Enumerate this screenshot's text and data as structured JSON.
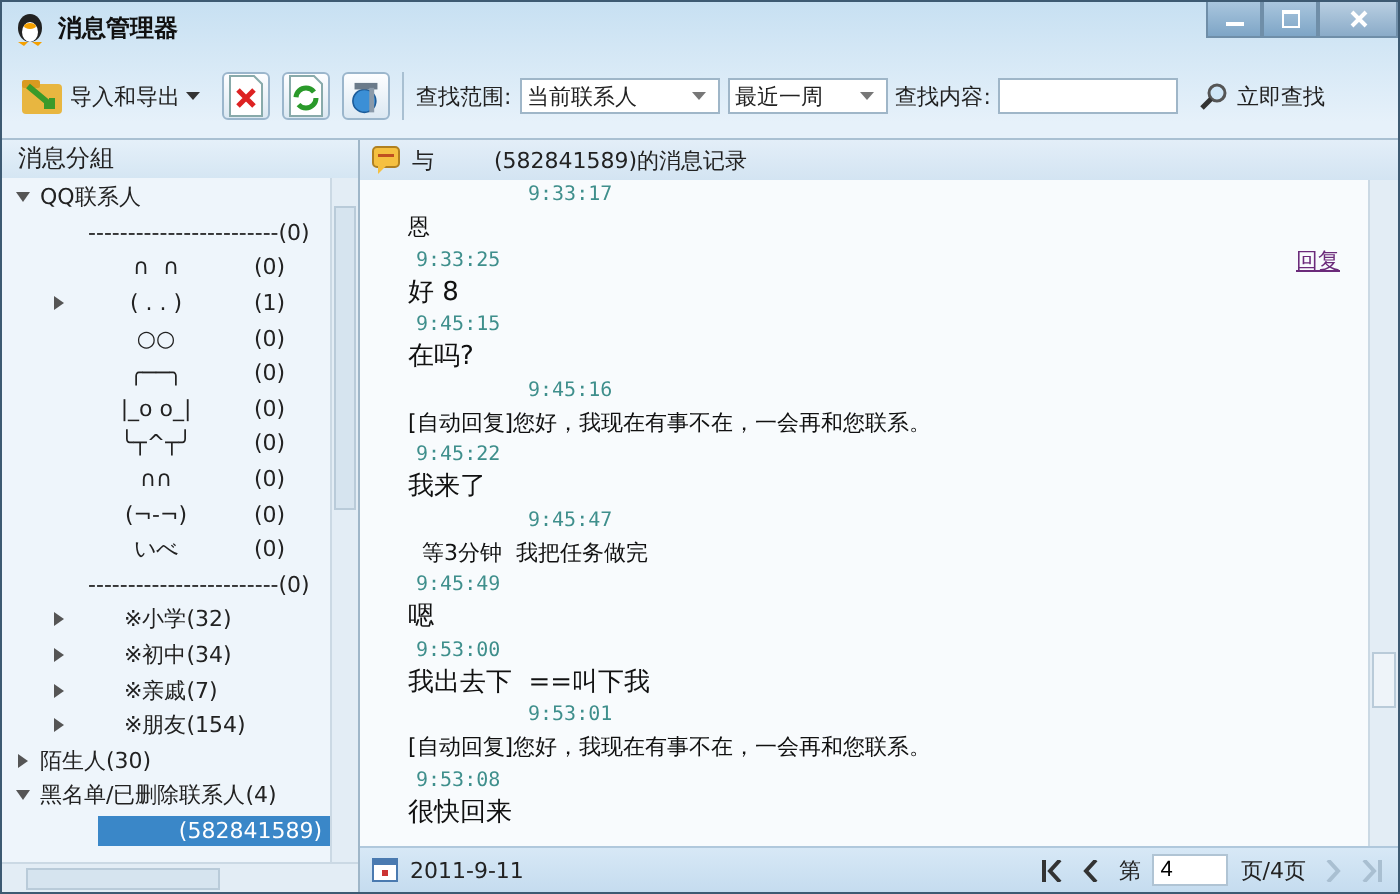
{
  "window": {
    "title": "消息管理器"
  },
  "toolbar": {
    "import_export": "导入和导出",
    "scope_label": "查找范围:",
    "scope": "当前联系人",
    "period": "最近一周",
    "content_label": "查找内容:",
    "search_button": "立即查找"
  },
  "sidebar": {
    "title": "消息分組",
    "tree": [
      {
        "label": "QQ联系人",
        "expanded": true,
        "children": [
          {
            "label": "------------------------(0)"
          },
          {
            "label": "∩  ∩",
            "count": "(0)"
          },
          {
            "label": "( . . )",
            "count": "(1)",
            "expanded": false
          },
          {
            "label": "○○",
            "count": "(0)"
          },
          {
            "label": "╭──╮",
            "count": "(0)"
          },
          {
            "label": "|_o o_|",
            "count": "(0)"
          },
          {
            "label": "╰┬^┬╯",
            "count": "(0)"
          },
          {
            "label": "∩∩",
            "count": "(0)"
          },
          {
            "label": "(¬-¬)",
            "count": "(0)"
          },
          {
            "label": "いべ",
            "count": "(0)"
          },
          {
            "label": "------------------------(0)"
          },
          {
            "label": "※小学(32)",
            "expanded": false
          },
          {
            "label": "※初中(34)",
            "expanded": false
          },
          {
            "label": "※亲戚(7)",
            "expanded": false
          },
          {
            "label": "※朋友(154)",
            "expanded": false
          }
        ]
      },
      {
        "label": "陌生人(30)",
        "expanded": false
      },
      {
        "label": "黑名单/已删除联系人(4)",
        "expanded": true,
        "children": [
          {
            "label": "(582841589)",
            "selected": true
          }
        ]
      }
    ]
  },
  "conversation": {
    "prefix": "与",
    "title": "(582841589)的消息记录",
    "messages": [
      {
        "kind": "self",
        "time": "9:33:17",
        "text": "恩",
        "large": false
      },
      {
        "kind": "other",
        "time": "9:33:25",
        "text": "好 8",
        "large": true,
        "reply": "回复"
      },
      {
        "kind": "other",
        "time": "9:45:15",
        "text": "在吗?",
        "large": true
      },
      {
        "kind": "self",
        "time": "9:45:16",
        "text": "[自动回复]您好，我现在有事不在，一会再和您联系。",
        "large": false
      },
      {
        "kind": "other",
        "time": "9:45:22",
        "text": "我来了",
        "large": true
      },
      {
        "kind": "self",
        "time": "9:45:47",
        "text": "  等3分钟  我把任务做完",
        "large": false
      },
      {
        "kind": "other",
        "time": "9:45:49",
        "text": "嗯",
        "large": true
      },
      {
        "kind": "other",
        "time": "9:53:00",
        "text": "我出去下  ==叫下我",
        "large": true
      },
      {
        "kind": "self",
        "time": "9:53:01",
        "text": "[自动回复]您好，我现在有事不在，一会再和您联系。",
        "large": false
      },
      {
        "kind": "other",
        "time": "9:53:08",
        "text": "很快回来",
        "large": true
      }
    ]
  },
  "footer": {
    "date": "2011-9-11",
    "page_prefix": "第",
    "page": "4",
    "page_suffix": "页/4页",
    "first_disabled": false,
    "prev_disabled": false,
    "next_disabled": true,
    "last_disabled": true
  }
}
